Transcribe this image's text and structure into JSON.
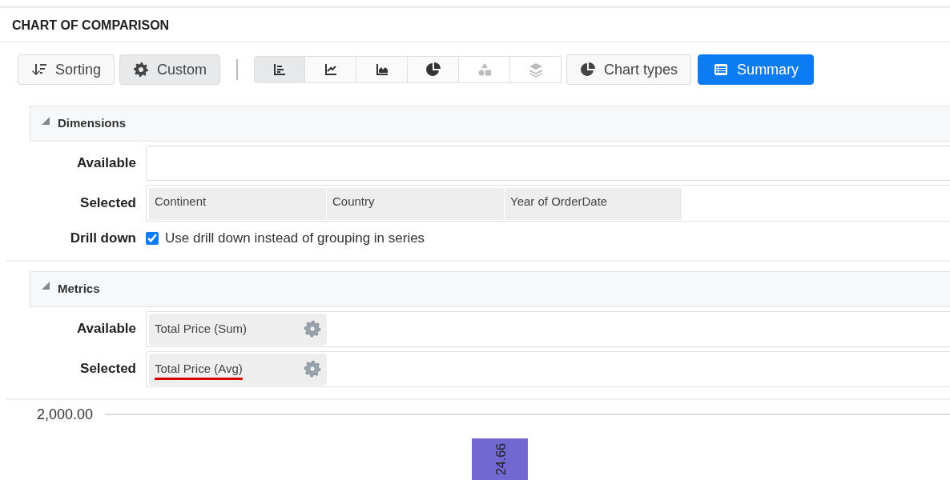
{
  "header": {
    "title": "CHART OF COMPARISON"
  },
  "toolbar": {
    "sorting": {
      "label": "Sorting"
    },
    "custom": {
      "label": "Custom",
      "selected": true
    },
    "chart_buttons": [
      {
        "kind": "bar",
        "selected": true,
        "disabled": false
      },
      {
        "kind": "line",
        "selected": false,
        "disabled": false
      },
      {
        "kind": "area",
        "selected": false,
        "disabled": false
      },
      {
        "kind": "pie",
        "selected": false,
        "disabled": false
      },
      {
        "kind": "shapes",
        "selected": false,
        "disabled": true
      },
      {
        "kind": "layers",
        "selected": false,
        "disabled": true
      }
    ],
    "chart_types": {
      "label": "Chart types"
    },
    "summary": {
      "label": "Summary"
    }
  },
  "dimensions": {
    "title": "Dimensions",
    "expanded": true,
    "available_label": "Available",
    "selected_label": "Selected",
    "selected": [
      "Continent",
      "Country",
      "Year of OrderDate"
    ],
    "drill_down": {
      "label": "Drill down",
      "text": "Use drill down instead of grouping in series",
      "checked": true
    }
  },
  "metrics": {
    "title": "Metrics",
    "expanded": true,
    "available_label": "Available",
    "available": [
      {
        "label": "Total Price (Sum)",
        "underlined": false
      }
    ],
    "selected_label": "Selected",
    "selected": [
      {
        "label": "Total Price (Avg)",
        "underlined": true
      }
    ]
  },
  "chart": {
    "tick_label": "2,000.00",
    "bar_label": "24.66"
  }
}
